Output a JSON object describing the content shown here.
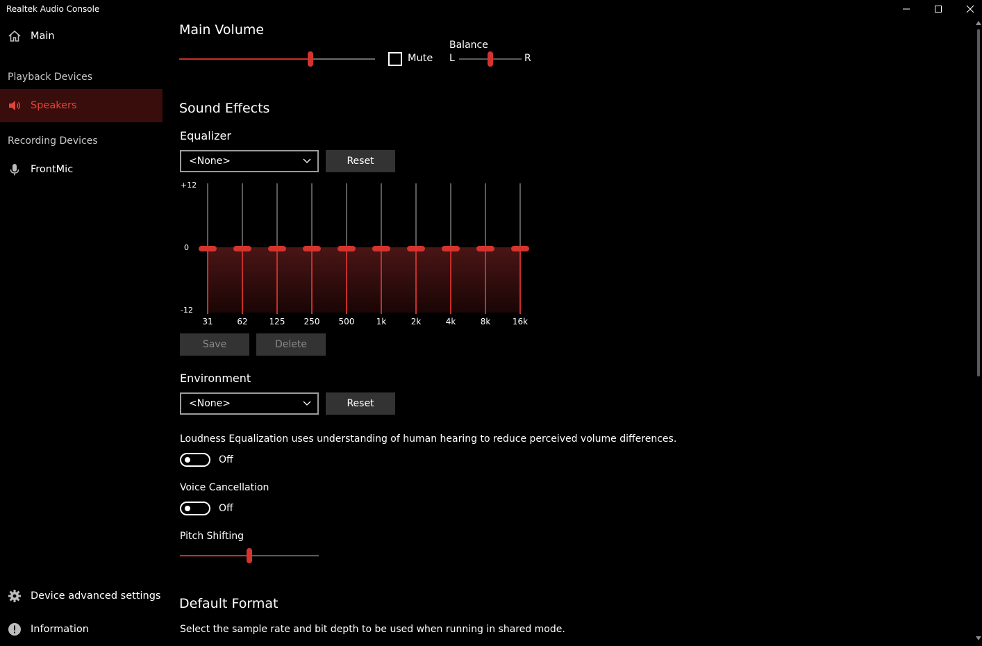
{
  "window": {
    "title": "Realtek Audio Console"
  },
  "sidebar": {
    "main_label": "Main",
    "playback_header": "Playback Devices",
    "speakers_label": "Speakers",
    "recording_header": "Recording Devices",
    "frontmic_label": "FrontMic",
    "advanced_label": "Device advanced settings",
    "info_label": "Information"
  },
  "main_volume": {
    "title": "Main Volume",
    "level": 0.67,
    "mute_label": "Mute",
    "muted": false,
    "balance_label": "Balance",
    "balance_left": "L",
    "balance_right": "R",
    "balance_level": 0.5
  },
  "sound_effects": {
    "title": "Sound Effects",
    "equalizer_label": "Equalizer",
    "equalizer_preset": "<None>",
    "reset_label": "Reset",
    "eq_max": "+12",
    "eq_zero": "0",
    "eq_min": "-12",
    "bands": [
      "31",
      "62",
      "125",
      "250",
      "500",
      "1k",
      "2k",
      "4k",
      "8k",
      "16k"
    ],
    "band_values": [
      0,
      0,
      0,
      0,
      0,
      0,
      0,
      0,
      0,
      0
    ],
    "save_label": "Save",
    "delete_label": "Delete",
    "environment_label": "Environment",
    "environment_preset": "<None>",
    "env_reset_label": "Reset",
    "loudness_text": "Loudness Equalization uses understanding of human hearing to reduce perceived volume differences.",
    "loudness_state": "Off",
    "voice_label": "Voice Cancellation",
    "voice_state": "Off",
    "pitch_label": "Pitch Shifting",
    "pitch_level": 0.5
  },
  "default_format": {
    "title": "Default Format",
    "description": "Select the sample rate and bit depth to be used when running in shared mode."
  },
  "colors": {
    "accent": "#d4342e",
    "selected_bg": "#3a0d0d"
  }
}
